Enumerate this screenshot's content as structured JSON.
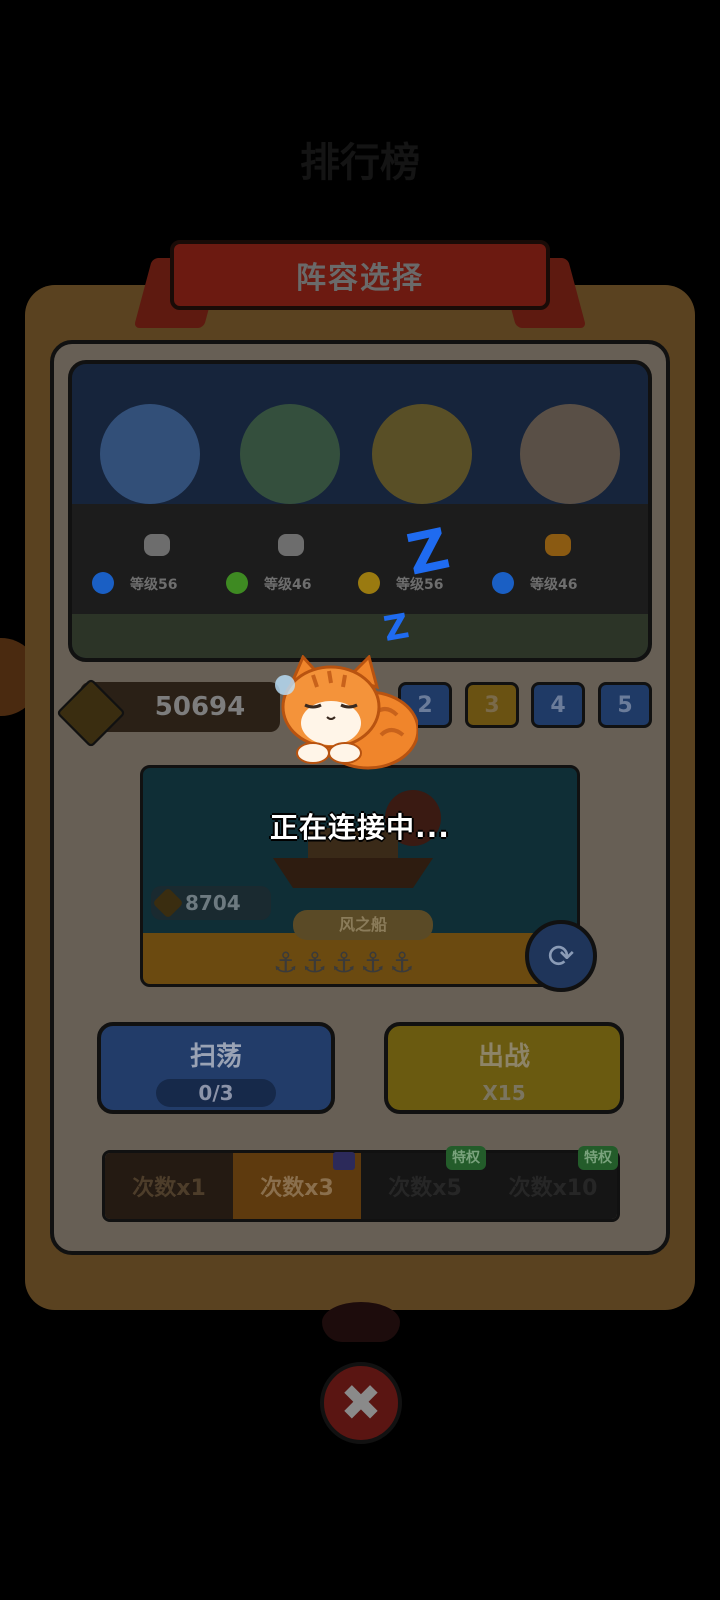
{
  "background": {
    "ghost_title": "排行榜"
  },
  "panel": {
    "title": "阵容选择"
  },
  "heroes": [
    {
      "level": "等级56",
      "element_icon": "water-drop-icon",
      "element_color": "#1a5fc4",
      "tint": "#3a5a88",
      "paw_color": "#6d6d6d"
    },
    {
      "level": "等级46",
      "element_icon": "wind-icon",
      "element_color": "#3e8a22",
      "tint": "#3c5a3e",
      "paw_color": "#6d6d6d"
    },
    {
      "level": "等级56",
      "element_icon": "lightning-icon",
      "element_color": "#9a7a10",
      "tint": "#6a5a22",
      "paw_color": "#6d6d6d"
    },
    {
      "level": "等级46",
      "element_icon": "water-drop-icon",
      "element_color": "#1a5fc4",
      "tint": "#6a5a4a",
      "paw_color": "#8a5a12"
    }
  ],
  "power": {
    "value": "50694",
    "icon": "paw-badge-icon"
  },
  "formation_slots": [
    {
      "label": "2",
      "color": "#1f3a66",
      "text_color": "#6b7c9a"
    },
    {
      "label": "3",
      "color": "#6a5212",
      "text_color": "#7a6a4a"
    },
    {
      "label": "4",
      "color": "#1f3a66",
      "text_color": "#6b7c9a"
    },
    {
      "label": "5",
      "color": "#1f3a66",
      "text_color": "#6b7c9a"
    }
  ],
  "ship": {
    "name": "风之船",
    "power": "8704",
    "anchors": "⚓⚓⚓⚓⚓"
  },
  "buttons": {
    "sweep": {
      "label": "扫荡",
      "count": "0/3"
    },
    "battle": {
      "label": "出战",
      "cost": "X15"
    }
  },
  "count_tabs": [
    {
      "label": "次数x1"
    },
    {
      "label": "次数x3"
    },
    {
      "label": "次数x5"
    },
    {
      "label": "次数x10"
    }
  ],
  "privilege_tag": "特权",
  "loading": {
    "text": "正在连接中...",
    "z_big": "Z",
    "z_small": "Z"
  }
}
